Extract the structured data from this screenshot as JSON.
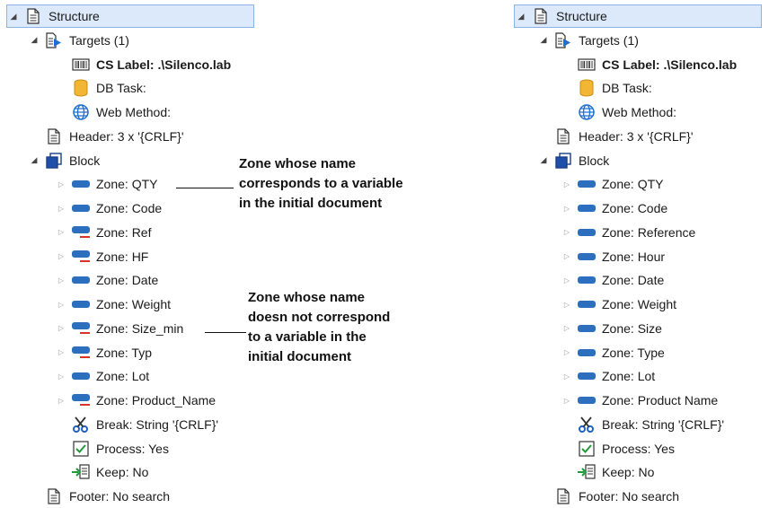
{
  "left_tree": {
    "items": [
      {
        "label": "Structure",
        "icon": "document-icon",
        "arrow": "expanded",
        "level": 0,
        "selected": true
      },
      {
        "label": "Targets (1)",
        "icon": "targets-icon",
        "arrow": "expanded",
        "level": 1
      },
      {
        "label": "CS Label: .\\Silenco.lab",
        "icon": "barcode-icon",
        "arrow": "none",
        "level": 2,
        "bold": true
      },
      {
        "label": "DB Task:",
        "icon": "database-icon",
        "arrow": "none",
        "level": 2
      },
      {
        "label": "Web Method:",
        "icon": "globe-icon",
        "arrow": "none",
        "level": 2
      },
      {
        "label": "Header: 3 x '{CRLF}'",
        "icon": "document-icon",
        "arrow": "none",
        "level": 1
      },
      {
        "label": "Block",
        "icon": "block-icon",
        "arrow": "expanded",
        "level": 1
      },
      {
        "label": "Zone: QTY",
        "icon": "zone-icon",
        "arrow": "collapsed",
        "level": 2
      },
      {
        "label": "Zone: Code",
        "icon": "zone-icon",
        "arrow": "collapsed",
        "level": 2
      },
      {
        "label": "Zone: Ref",
        "icon": "zone-unmatched-icon",
        "arrow": "collapsed",
        "level": 2
      },
      {
        "label": "Zone: HF",
        "icon": "zone-unmatched-icon",
        "arrow": "collapsed",
        "level": 2
      },
      {
        "label": "Zone: Date",
        "icon": "zone-icon",
        "arrow": "collapsed",
        "level": 2
      },
      {
        "label": "Zone: Weight",
        "icon": "zone-icon",
        "arrow": "collapsed",
        "level": 2
      },
      {
        "label": "Zone: Size_min",
        "icon": "zone-unmatched-icon",
        "arrow": "collapsed",
        "level": 2
      },
      {
        "label": "Zone: Typ",
        "icon": "zone-unmatched-icon",
        "arrow": "collapsed",
        "level": 2
      },
      {
        "label": "Zone: Lot",
        "icon": "zone-icon",
        "arrow": "collapsed",
        "level": 2
      },
      {
        "label": "Zone: Product_Name",
        "icon": "zone-unmatched-icon",
        "arrow": "collapsed",
        "level": 2
      },
      {
        "label": "Break: String '{CRLF}'",
        "icon": "scissors-icon",
        "arrow": "none",
        "level": 2
      },
      {
        "label": "Process: Yes",
        "icon": "checkbox-icon",
        "arrow": "none",
        "level": 2
      },
      {
        "label": "Keep: No",
        "icon": "keep-icon",
        "arrow": "none",
        "level": 2
      },
      {
        "label": "Footer: No search",
        "icon": "document-icon",
        "arrow": "none",
        "level": 1
      }
    ]
  },
  "right_tree": {
    "items": [
      {
        "label": "Structure",
        "icon": "document-icon",
        "arrow": "expanded",
        "level": 0,
        "selected": true
      },
      {
        "label": "Targets (1)",
        "icon": "targets-icon",
        "arrow": "expanded",
        "level": 1
      },
      {
        "label": "CS Label: .\\Silenco.lab",
        "icon": "barcode-icon",
        "arrow": "none",
        "level": 2,
        "bold": true
      },
      {
        "label": "DB Task:",
        "icon": "database-icon",
        "arrow": "none",
        "level": 2
      },
      {
        "label": "Web Method:",
        "icon": "globe-icon",
        "arrow": "none",
        "level": 2
      },
      {
        "label": "Header: 3 x '{CRLF}'",
        "icon": "document-icon",
        "arrow": "none",
        "level": 1
      },
      {
        "label": "Block",
        "icon": "block-icon",
        "arrow": "expanded",
        "level": 1
      },
      {
        "label": "Zone: QTY",
        "icon": "zone-icon",
        "arrow": "collapsed",
        "level": 2
      },
      {
        "label": "Zone: Code",
        "icon": "zone-icon",
        "arrow": "collapsed",
        "level": 2
      },
      {
        "label": "Zone: Reference",
        "icon": "zone-icon",
        "arrow": "collapsed",
        "level": 2
      },
      {
        "label": "Zone: Hour",
        "icon": "zone-icon",
        "arrow": "collapsed",
        "level": 2
      },
      {
        "label": "Zone: Date",
        "icon": "zone-icon",
        "arrow": "collapsed",
        "level": 2
      },
      {
        "label": "Zone: Weight",
        "icon": "zone-icon",
        "arrow": "collapsed",
        "level": 2
      },
      {
        "label": "Zone: Size",
        "icon": "zone-icon",
        "arrow": "collapsed",
        "level": 2
      },
      {
        "label": "Zone: Type",
        "icon": "zone-icon",
        "arrow": "collapsed",
        "level": 2
      },
      {
        "label": "Zone: Lot",
        "icon": "zone-icon",
        "arrow": "collapsed",
        "level": 2
      },
      {
        "label": "Zone: Product Name",
        "icon": "zone-icon",
        "arrow": "collapsed",
        "level": 2
      },
      {
        "label": "Break: String '{CRLF}'",
        "icon": "scissors-icon",
        "arrow": "none",
        "level": 2
      },
      {
        "label": "Process: Yes",
        "icon": "checkbox-icon",
        "arrow": "none",
        "level": 2
      },
      {
        "label": "Keep: No",
        "icon": "keep-icon",
        "arrow": "none",
        "level": 2
      },
      {
        "label": "Footer: No search",
        "icon": "document-icon",
        "arrow": "none",
        "level": 1
      }
    ]
  },
  "annotations": {
    "matched": [
      "Zone whose name",
      "corresponds to a variable",
      "in the initial document"
    ],
    "unmatched": [
      "Zone whose name",
      "doesn not correspond",
      "to a variable in the",
      "initial document"
    ]
  },
  "colors": {
    "zone": "#2c6fbf",
    "unmatched_underline": "#d9342b",
    "selection": "#dbe9fb",
    "selection_border": "#8db2e3"
  }
}
